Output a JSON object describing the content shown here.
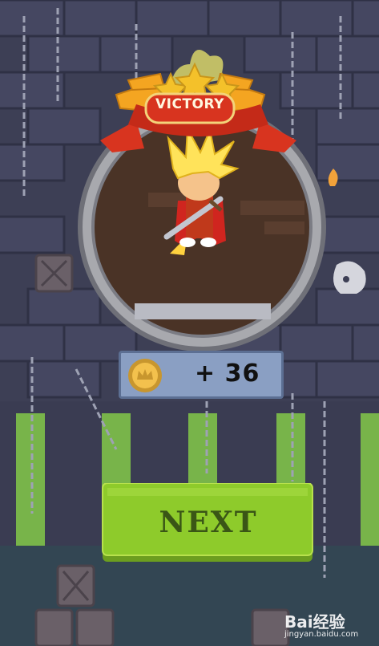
{
  "banner": {
    "title": "VICTORY",
    "stars": 3
  },
  "reward": {
    "amount_text": "+ 36",
    "icon": "crown-coin-icon"
  },
  "next_button": {
    "label": "NEXT"
  },
  "watermark": {
    "text": "Bai经验",
    "url": "jingyan.baidu.com"
  },
  "colors": {
    "wall": "#3d3f55",
    "brick": "#454761",
    "portal_bg": "#4a3326",
    "ribbon": "#d8341f",
    "gold": "#f4c12a",
    "button": "#8ecb2b",
    "panel": "#8a9fc3",
    "hero_hair": "#ffe35a",
    "hero_cape": "#d0251f"
  }
}
